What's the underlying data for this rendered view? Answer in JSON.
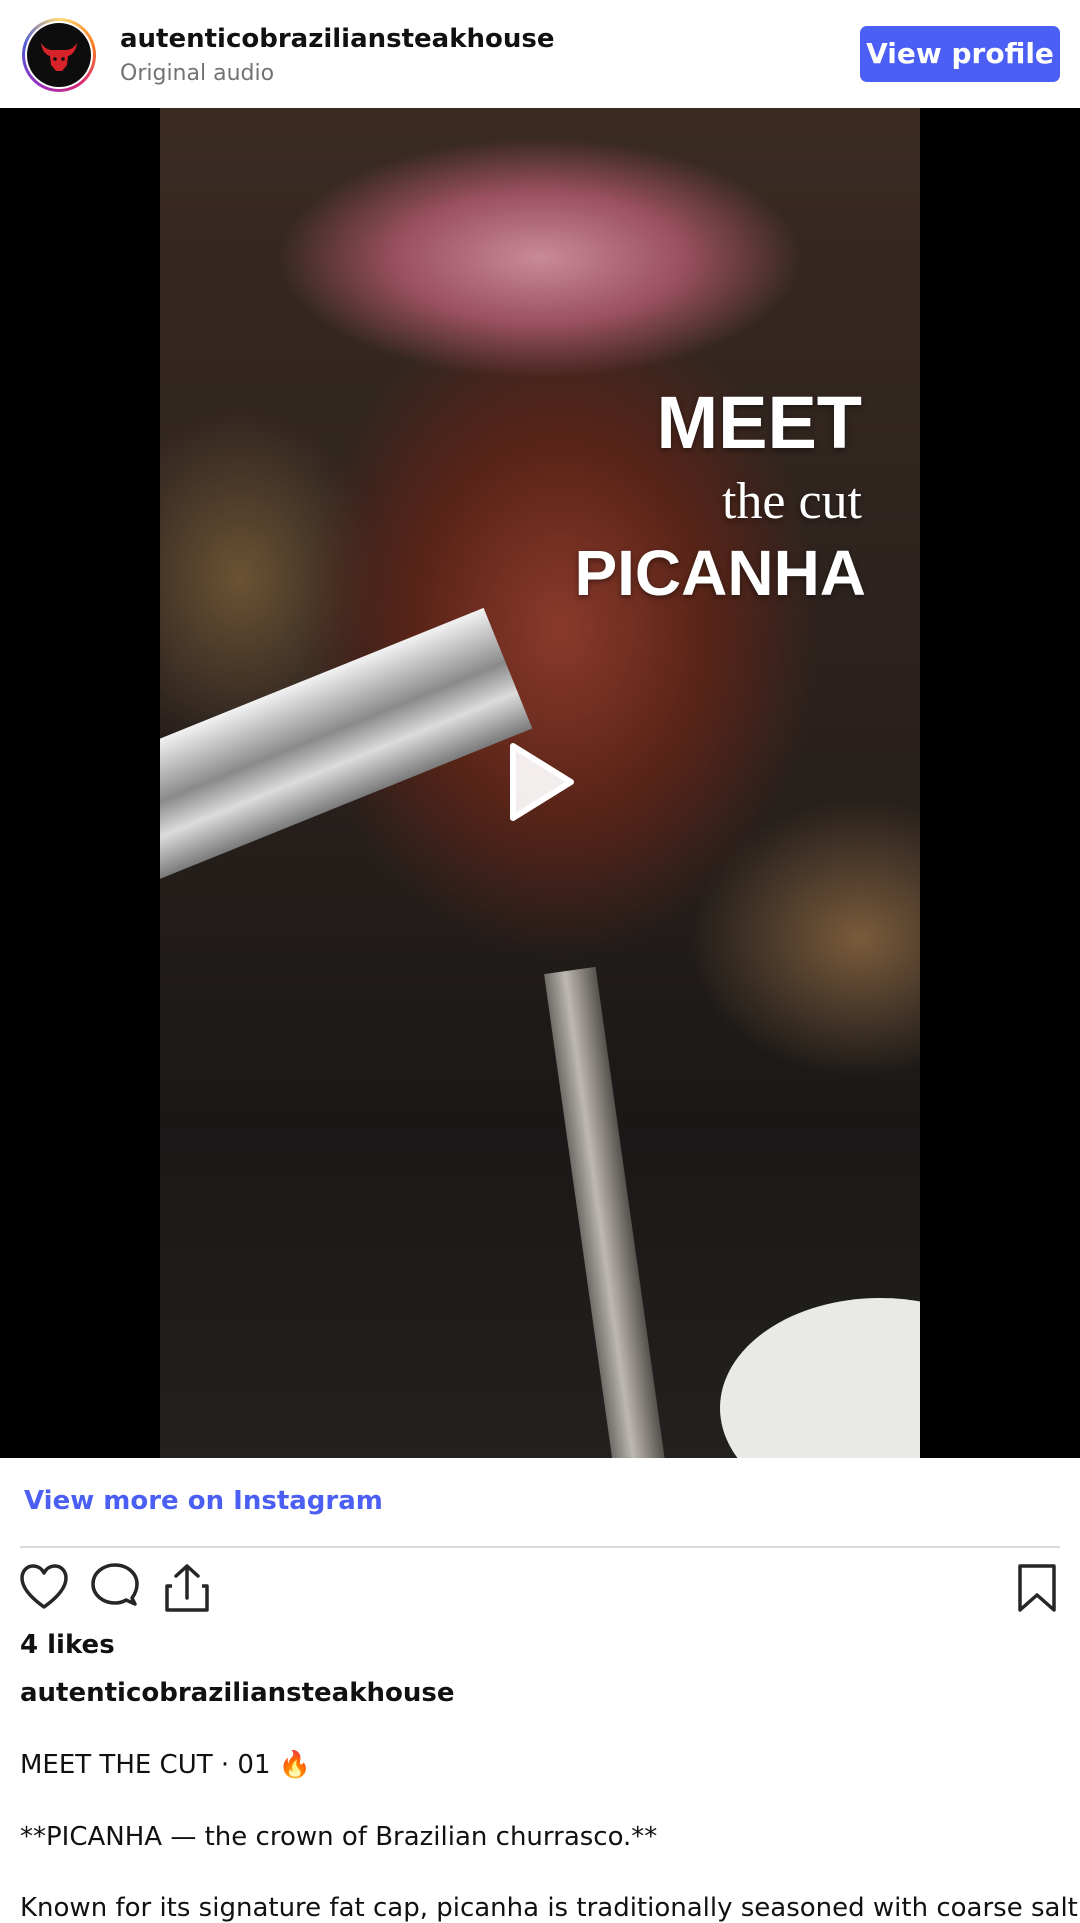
{
  "header": {
    "account_name": "autenticobraziliansteakhouse",
    "audio_label": "Original audio",
    "view_profile_label": "View profile"
  },
  "media": {
    "overlay": {
      "line1": "MEET",
      "line2": "the cut",
      "line3": "PICANHA"
    },
    "play_icon": "play-icon"
  },
  "links": {
    "view_more": "View more on Instagram"
  },
  "actions": {
    "icons": [
      "heart-icon",
      "comment-icon",
      "share-icon",
      "bookmark-icon"
    ]
  },
  "post": {
    "likes": "4 likes",
    "caption_user": "autenticobraziliansteakhouse",
    "caption_lines": [
      "MEET THE CUT · 01",
      "**PICANHA — the crown of Brazilian churrasco.**",
      "Known for its signature fat cap, picanha is traditionally seasoned with coarse salt,"
    ],
    "emoji": "🔥"
  },
  "colors": {
    "accent": "#4c5ff4",
    "muted_text": "#737373",
    "divider": "#dbdbdb",
    "media_background": "#000000"
  }
}
